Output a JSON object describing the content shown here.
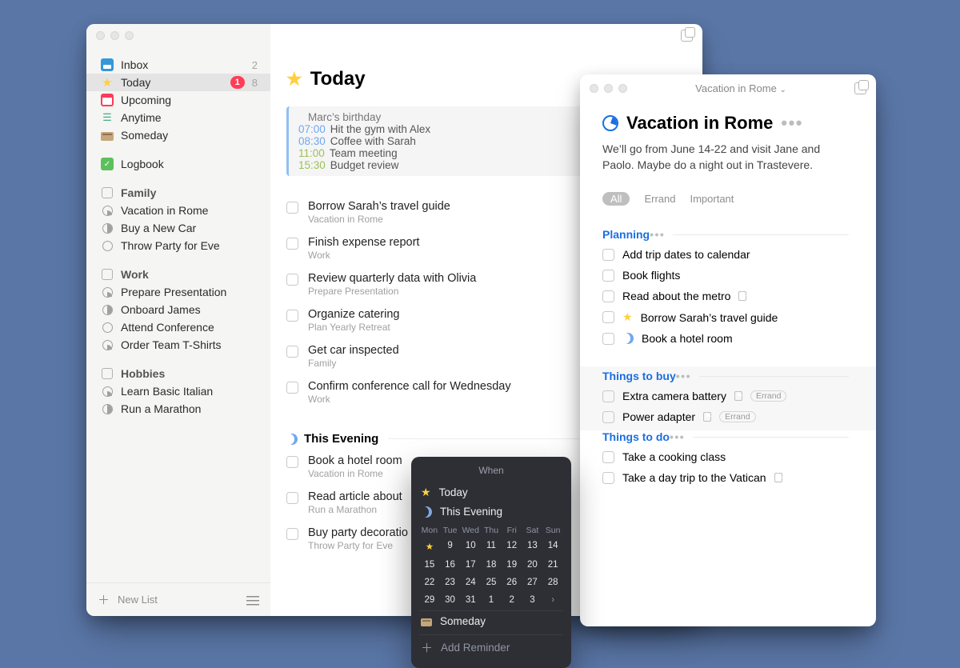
{
  "sidebar": {
    "default_lists": [
      {
        "id": "inbox",
        "label": "Inbox",
        "count": "2"
      },
      {
        "id": "today",
        "label": "Today",
        "alert": "1",
        "count": "8",
        "selected": true
      },
      {
        "id": "upcoming",
        "label": "Upcoming"
      },
      {
        "id": "anytime",
        "label": "Anytime"
      },
      {
        "id": "someday",
        "label": "Someday"
      }
    ],
    "logbook": "Logbook",
    "areas": [
      {
        "name": "Family",
        "projects": [
          {
            "label": "Vacation in Rome"
          },
          {
            "label": "Buy a New Car"
          },
          {
            "label": "Throw Party for Eve"
          }
        ]
      },
      {
        "name": "Work",
        "projects": [
          {
            "label": "Prepare Presentation"
          },
          {
            "label": "Onboard James"
          },
          {
            "label": "Attend Conference"
          },
          {
            "label": "Order Team T-Shirts"
          }
        ]
      },
      {
        "name": "Hobbies",
        "projects": [
          {
            "label": "Learn Basic Italian"
          },
          {
            "label": "Run a Marathon"
          }
        ]
      }
    ],
    "new_list": "New List"
  },
  "today": {
    "title": "Today",
    "calendar": [
      {
        "kind": "allday",
        "text": "Marc’s birthday"
      },
      {
        "kind": "a",
        "time": "07:00",
        "text": "Hit the gym with Alex"
      },
      {
        "kind": "a",
        "time": "08:30",
        "text": "Coffee with Sarah"
      },
      {
        "kind": "b",
        "time": "11:00",
        "text": "Team meeting"
      },
      {
        "kind": "b",
        "time": "15:30",
        "text": "Budget review"
      }
    ],
    "tasks": [
      {
        "title": "Borrow Sarah’s travel guide",
        "sub": "Vacation in Rome"
      },
      {
        "title": "Finish expense report",
        "sub": "Work"
      },
      {
        "title": "Review quarterly data with Olivia",
        "sub": "Prepare Presentation"
      },
      {
        "title": "Organize catering",
        "sub": "Plan Yearly Retreat"
      },
      {
        "title": "Get car inspected",
        "sub": "Family"
      },
      {
        "title": "Confirm conference call for Wednesday",
        "sub": "Work"
      }
    ],
    "evening_header": "This Evening",
    "evening": [
      {
        "title": "Book a hotel room",
        "sub": "Vacation in Rome"
      },
      {
        "title": "Read article about",
        "sub": "Run a Marathon"
      },
      {
        "title": "Buy party decoratio",
        "sub": "Throw Party for Eve"
      }
    ]
  },
  "project": {
    "window_title": "Vacation in Rome",
    "title": "Vacation in Rome",
    "desc": "We’ll go from June 14-22 and visit Jane and Paolo. Maybe do a night out in Trastevere.",
    "filters": [
      "All",
      "Errand",
      "Important"
    ],
    "sections": [
      {
        "name": "Planning",
        "tasks": [
          {
            "t": "Add trip dates to calendar"
          },
          {
            "t": "Book flights"
          },
          {
            "t": "Read about the metro",
            "attach": true
          },
          {
            "t": "Borrow Sarah’s travel guide",
            "star": true
          },
          {
            "t": "Book a hotel room",
            "moon": true
          }
        ]
      },
      {
        "name": "Things to buy",
        "sold": true,
        "tasks": [
          {
            "t": "Extra camera battery",
            "attach": true,
            "tag": "Errand"
          },
          {
            "t": "Power adapter",
            "attach": true,
            "tag": "Errand"
          }
        ]
      },
      {
        "name": "Things to do",
        "tasks": [
          {
            "t": "Take a cooking class"
          },
          {
            "t": "Take a day trip to the Vatican",
            "attach": true
          }
        ]
      }
    ]
  },
  "popover": {
    "header": "When",
    "today": "Today",
    "evening": "This Evening",
    "dow": [
      "Mon",
      "Tue",
      "Wed",
      "Thu",
      "Fri",
      "Sat",
      "Sun"
    ],
    "weeks": [
      [
        "★",
        "9",
        "10",
        "11",
        "12",
        "13",
        "14"
      ],
      [
        "15",
        "16",
        "17",
        "18",
        "19",
        "20",
        "21"
      ],
      [
        "22",
        "23",
        "24",
        "25",
        "26",
        "27",
        "28"
      ],
      [
        "29",
        "30",
        "31",
        "1",
        "2",
        "3",
        "›"
      ]
    ],
    "someday": "Someday",
    "add_reminder": "Add Reminder"
  }
}
